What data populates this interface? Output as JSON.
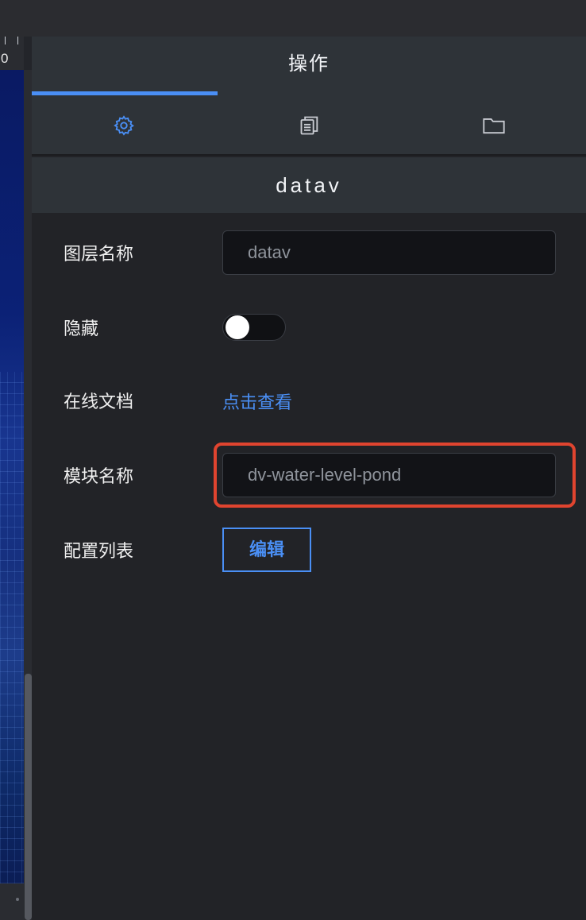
{
  "canvas": {
    "ruler_value": "0"
  },
  "panel": {
    "tab_title": "操作",
    "icons": [
      "gear-icon",
      "copy-icon",
      "folder-icon"
    ],
    "section_title": "datav",
    "accent_color": "#4a8ff5",
    "highlight_color": "#e0442f"
  },
  "form": {
    "layer_name": {
      "label": "图层名称",
      "value": "datav"
    },
    "hidden": {
      "label": "隐藏",
      "on": false
    },
    "online_doc": {
      "label": "在线文档",
      "link": "点击查看"
    },
    "module_name": {
      "label": "模块名称",
      "value": "dv-water-level-pond"
    },
    "config_list": {
      "label": "配置列表",
      "button": "编辑"
    }
  }
}
